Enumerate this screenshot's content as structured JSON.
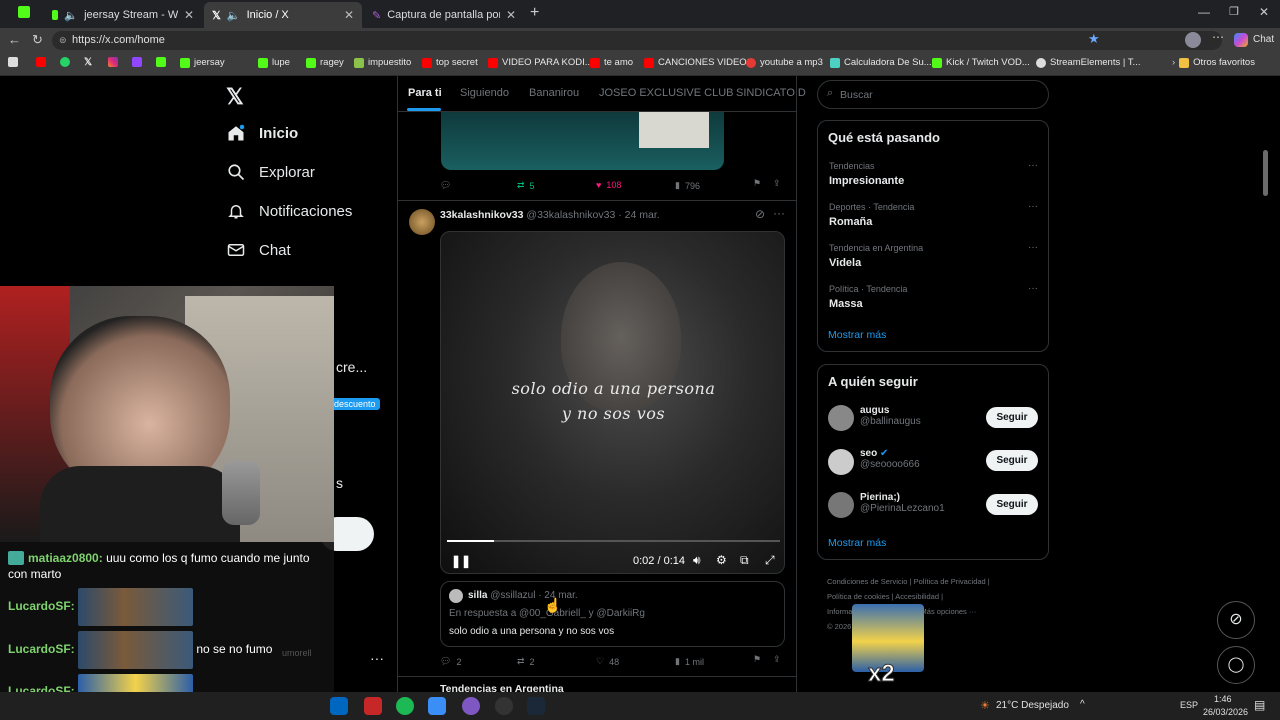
{
  "browser": {
    "tabs": [
      {
        "label": "jeersay Stream - Watch Live o"
      },
      {
        "label": "Inicio / X"
      },
      {
        "label": "Captura de pantalla por Lightshot"
      }
    ],
    "url": "https://x.com/home",
    "profile_label": "Chat",
    "bookmarks": [
      "jeersay",
      "lupe",
      "ragey",
      "impuestito",
      "top secret",
      "VIDEO PARA KODI...",
      "te amo",
      "CANCIONES VIDEOS",
      "youtube a mp3",
      "Calculadora De Su...",
      "Kick / Twitch VOD...",
      "StreamElements | T...",
      "Otros favoritos"
    ]
  },
  "nav": {
    "items": [
      "Inicio",
      "Explorar",
      "Notificaciones",
      "Chat"
    ],
    "partial_text_1": "cre...",
    "badge": "descuento",
    "partial_text_2": "s"
  },
  "feed_tabs": [
    "Para ti",
    "Siguiendo",
    "Bananirou",
    "JOSEO EXCLUSIVE CLUB",
    "SINDICATO D"
  ],
  "prev_post": {
    "retweets": "5",
    "likes": "108",
    "views": "796"
  },
  "post": {
    "author": "33kalashnikov33",
    "handle": "@33kalashnikov33",
    "date": "· 24 mar.",
    "video_caption_1": "solo odio a una persona",
    "video_caption_2": "y no sos vos",
    "video_time": "0:02 / 0:14",
    "video_progress": 0.14,
    "quote_author": "silla",
    "quote_handle": "@ssillazul",
    "quote_date": "· 24 mar.",
    "quote_reply": "En respuesta a @00_Gabriell_ y @DarkiiRg",
    "quote_text": "solo odio a una persona y no sos vos",
    "replies": "2",
    "retweets": "2",
    "likes": "48",
    "views": "1 mil"
  },
  "next_post_author": "Tendencias en Argentina",
  "search": {
    "placeholder": "Buscar"
  },
  "trends": {
    "title": "Qué está pasando",
    "items": [
      {
        "context": "Tendencias",
        "name": "Impresionante"
      },
      {
        "context": "Deportes · Tendencia",
        "name": "Romaña"
      },
      {
        "context": "Tendencia en Argentina",
        "name": "Videla"
      },
      {
        "context": "Política · Tendencia",
        "name": "Massa"
      }
    ],
    "show_more": "Mostrar más"
  },
  "who_to_follow": {
    "title": "A quién seguir",
    "users": [
      {
        "name": "augus",
        "handle": "@ballinaugus"
      },
      {
        "name": "seo",
        "handle": "@seoooo666"
      },
      {
        "name": "Pierina;)",
        "handle": "@PierinaLezcano1"
      }
    ],
    "follow_label": "Seguir",
    "show_more": "Mostrar más"
  },
  "footer": {
    "links": [
      "Condiciones de Servicio",
      "Política de Privacidad",
      "Política de cookies",
      "Accesibilidad",
      "Informa",
      "Más opciones ···"
    ],
    "copyright": "© 2026"
  },
  "stream_chat": [
    {
      "user": "matiaaz0800:",
      "text": "uuu como los q fumo cuando me junto con marto"
    },
    {
      "user": "LucardoSF:",
      "text": ""
    },
    {
      "user": "LucardoSF:",
      "text": "no se no fumo"
    },
    {
      "user": "LucardoSF:",
      "text": ""
    }
  ],
  "chat_user_faded": "umorell",
  "emote_overlay": "x2",
  "taskbar": {
    "weather": "21°C  Despejado",
    "lang": "ESP",
    "time": "1:46",
    "date": "26/03/2026"
  },
  "colors": {
    "accent": "#1d9bf0",
    "like": "#f91880",
    "retweet": "#00ba7c",
    "chat_user": "#7fd36e"
  }
}
